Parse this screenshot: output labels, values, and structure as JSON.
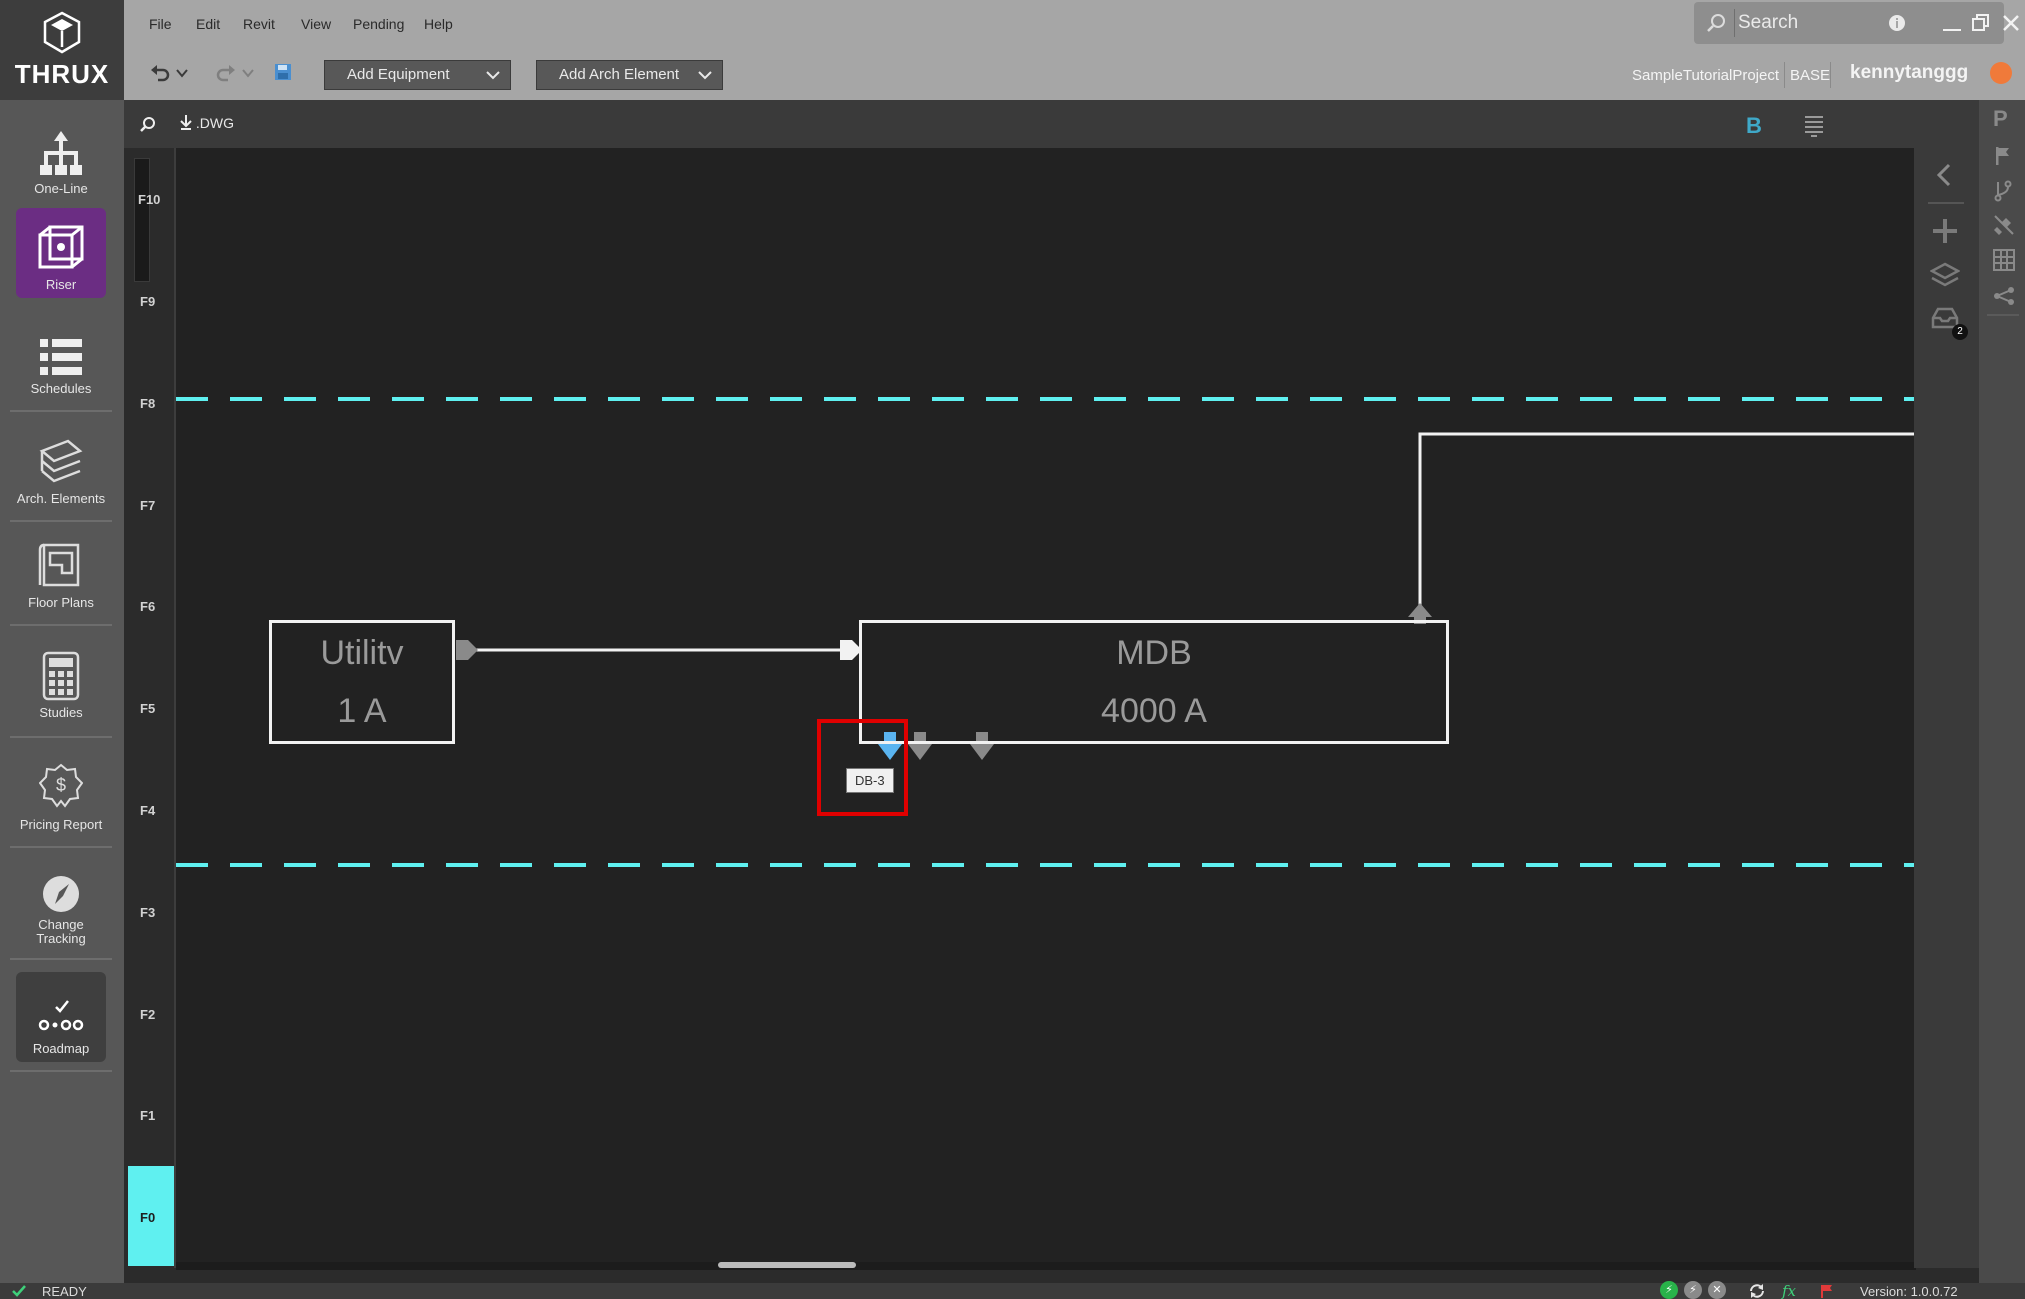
{
  "app": {
    "logo_text": "THRUX"
  },
  "sidebar": {
    "items": [
      {
        "label": "One-Line"
      },
      {
        "label": "Riser"
      },
      {
        "label": "Schedules"
      },
      {
        "label": "Arch. Elements"
      },
      {
        "label": "Floor Plans"
      },
      {
        "label": "Studies"
      },
      {
        "label": "Pricing Report"
      },
      {
        "label": "Change\nTracking"
      },
      {
        "label": "Roadmap"
      }
    ],
    "active": "Riser"
  },
  "menubar": {
    "items": [
      "File",
      "Edit",
      "Revit",
      "View",
      "Pending",
      "Help"
    ]
  },
  "toolbar": {
    "add_equipment": "Add Equipment",
    "add_arch_element": "Add Arch Element",
    "project_name": "SampleTutorialProject",
    "branch": "BASE",
    "username": "kennytanggg"
  },
  "search": {
    "placeholder": "Search"
  },
  "canvas_header": {
    "export_label": ".DWG"
  },
  "floors": [
    "F10",
    "F9",
    "F8",
    "F7",
    "F6",
    "F5",
    "F4",
    "F3",
    "F2",
    "F1",
    "F0"
  ],
  "selected_floor": "F0",
  "diagram": {
    "nodes": [
      {
        "name": "Utilitv",
        "rating": "1 A"
      },
      {
        "name": "MDB",
        "rating": "4000 A"
      }
    ],
    "tooltip": "DB-3",
    "accent_color": "#5ff0f0"
  },
  "right_panel": {
    "badge": "2"
  },
  "far_right": {
    "p_label": "P"
  },
  "statusbar": {
    "status": "READY",
    "version": "Version: 1.0.0.72"
  }
}
